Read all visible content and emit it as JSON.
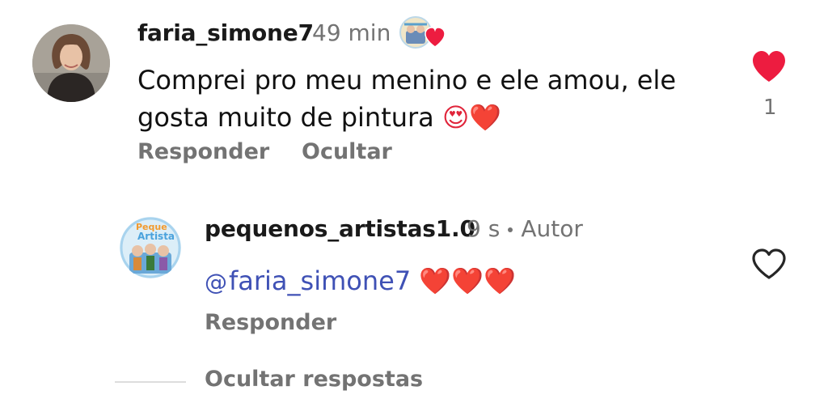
{
  "comment": {
    "username": "faria_simone7",
    "time": "49 min",
    "text_line1": "Comprei pro meu menino e ele amou, ele",
    "text_line2": "gosta muito de pintura",
    "emojis": "😍❤️",
    "reply_label": "Responder",
    "hide_label": "Ocultar",
    "like_count": "1",
    "liked": true
  },
  "reply": {
    "username": "pequenos_artistas1.0",
    "time": "9 s",
    "author_label": "Autor",
    "mention": "faria_simone7",
    "emojis": "❤️❤️❤️",
    "reply_label": "Responder",
    "liked": false
  },
  "thread": {
    "hide_replies_label": "Ocultar respostas"
  },
  "colors": {
    "like_red": "#ed1c40",
    "muted_text": "#737373",
    "mention_blue": "#3f51b5"
  }
}
